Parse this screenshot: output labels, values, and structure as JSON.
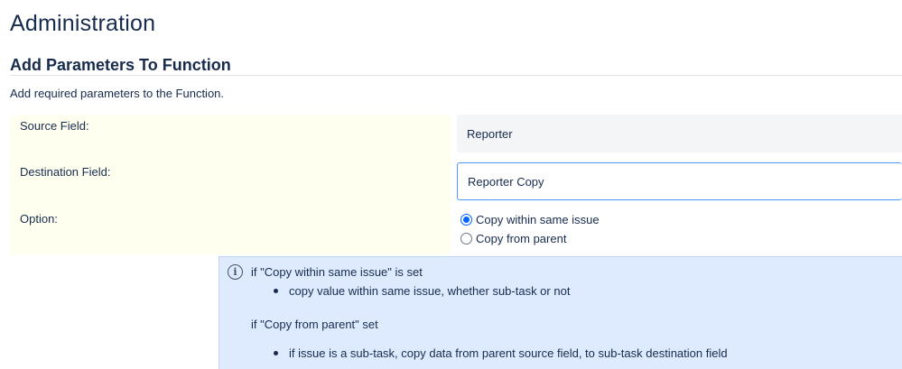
{
  "header": {
    "title": "Administration"
  },
  "section": {
    "title": "Add Parameters To Function",
    "description": "Add required parameters to the Function."
  },
  "form": {
    "source_field": {
      "label": "Source Field:",
      "value": "Reporter"
    },
    "destination_field": {
      "label": "Destination Field:",
      "value": "Reporter Copy"
    },
    "option": {
      "label": "Option:",
      "choices": [
        {
          "label": "Copy within same issue",
          "selected": true
        },
        {
          "label": "Copy from parent",
          "selected": false
        }
      ]
    }
  },
  "info": {
    "icon": "info-icon",
    "blocks": [
      {
        "heading": "if \"Copy within same issue\" is set",
        "bullets": [
          "copy value within same issue, whether sub-task or not"
        ]
      },
      {
        "heading": "if \"Copy from parent\" set",
        "bullets": [
          "if issue is a sub-task, copy data from parent source field, to sub-task destination field"
        ]
      }
    ]
  },
  "colors": {
    "label_background": "#fffff0",
    "readonly_background": "#f4f5f7",
    "input_border": "#4c9aff",
    "radio_accent": "#0065ff",
    "info_background": "#deebff"
  }
}
